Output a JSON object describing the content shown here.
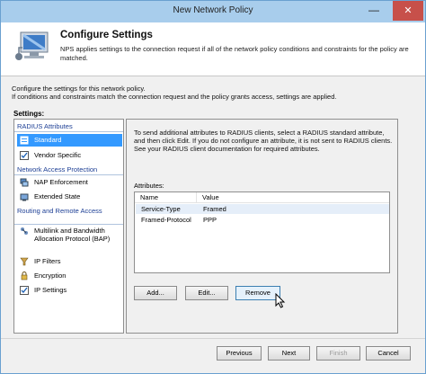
{
  "window": {
    "title": "New Network Policy",
    "minimize_glyph": "—",
    "close_glyph": "✕"
  },
  "header": {
    "title": "Configure Settings",
    "description": "NPS applies settings to the connection request if all of the network policy conditions and constraints for the policy are matched.",
    "icon": "network-computer-icon"
  },
  "intro": {
    "line1": "Configure the settings for this network policy.",
    "line2": "If conditions and constraints match the connection request and the policy grants access, settings are applied."
  },
  "settings": {
    "label": "Settings:",
    "groups": [
      {
        "header": "RADIUS Attributes",
        "items": [
          {
            "label": "Standard",
            "icon": "standard-attributes-icon",
            "selected": true
          },
          {
            "label": "Vendor Specific",
            "icon": "checkbox-icon",
            "selected": false
          }
        ]
      },
      {
        "header": "Network Access Protection",
        "items": [
          {
            "label": "NAP Enforcement",
            "icon": "nap-enforcement-icon",
            "selected": false
          },
          {
            "label": "Extended State",
            "icon": "extended-state-icon",
            "selected": false
          }
        ]
      },
      {
        "header": "Routing and Remote Access",
        "items": [
          {
            "label": "Multilink and Bandwidth Allocation Protocol (BAP)",
            "icon": "multilink-icon",
            "selected": false
          },
          {
            "label": "IP Filters",
            "icon": "ip-filters-icon",
            "selected": false
          },
          {
            "label": "Encryption",
            "icon": "lock-icon",
            "selected": false
          },
          {
            "label": "IP Settings",
            "icon": "checkbox-icon",
            "selected": false
          }
        ]
      }
    ]
  },
  "detail": {
    "description": "To send additional attributes to RADIUS clients, select a RADIUS standard attribute, and then click Edit. If you do not configure an attribute, it is not sent to RADIUS clients. See your RADIUS client documentation for required attributes.",
    "attributes_label": "Attributes:",
    "columns": [
      "Name",
      "Value"
    ],
    "rows": [
      {
        "name": "Service-Type",
        "value": "Framed"
      },
      {
        "name": "Framed-Protocol",
        "value": "PPP"
      }
    ],
    "buttons": {
      "add": "Add...",
      "edit": "Edit...",
      "remove": "Remove"
    }
  },
  "footer": {
    "previous": "Previous",
    "next": "Next",
    "finish": "Finish",
    "cancel": "Cancel"
  },
  "colors": {
    "titlebar": "#a8cdec",
    "close_button": "#c7504a",
    "selection": "#3399ff",
    "group_header": "#1d3f95"
  }
}
